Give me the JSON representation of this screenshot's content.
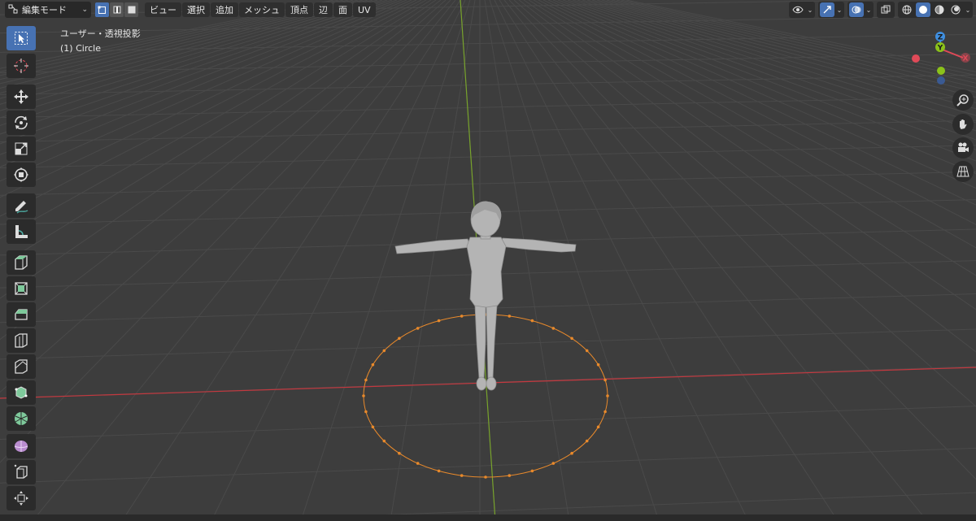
{
  "header": {
    "mode_label": "編集モード",
    "menus": [
      "ビュー",
      "選択",
      "追加",
      "メッシュ",
      "頂点",
      "辺",
      "面",
      "UV"
    ]
  },
  "overlay": {
    "view_name": "ユーザー・透視投影",
    "object_name": "(1) Circle"
  },
  "gizmo": {
    "z_label": "Z",
    "y_label": "Y",
    "x_label": "X"
  },
  "toolbar": {
    "tools": [
      "select-box",
      "cursor",
      "move",
      "rotate",
      "scale",
      "transform",
      "annotate",
      "measure",
      "add-cube",
      "extrude-region",
      "inset-faces",
      "bevel",
      "loop-cut",
      "knife",
      "poly-build",
      "spin",
      "smooth",
      "shrink-fatten",
      "shear"
    ],
    "active_tool": "select-box"
  },
  "colors": {
    "accent": "#4772b3",
    "grid_bg": "#3d3d3d",
    "x_axis": "#c4383f",
    "y_axis": "#78a32c",
    "selection": "#e8892b",
    "gizmo_x": "#e04a58",
    "gizmo_y": "#8bc21a",
    "gizmo_z": "#3f8fe0"
  }
}
